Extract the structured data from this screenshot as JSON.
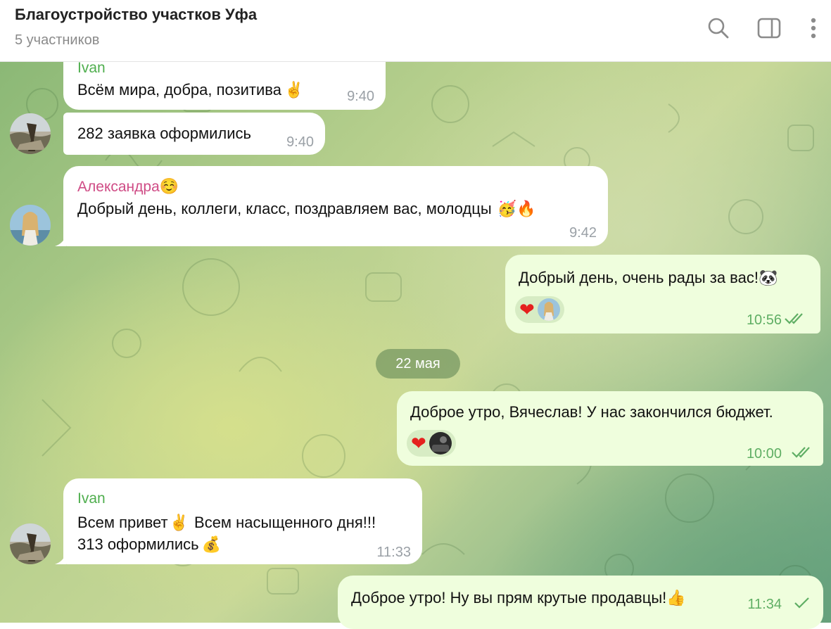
{
  "header": {
    "title": "Благоустройство участков Уфа",
    "subtitle": "5 участников",
    "icons": [
      "search-icon",
      "sidebar-toggle-icon",
      "more-vertical-icon"
    ]
  },
  "messages": [
    {
      "sender": "Ivan",
      "text": "Всём мира, добра, позитива",
      "emoji": "✌️",
      "time": "9:40"
    },
    {
      "text": "282 заявка оформились",
      "time": "9:40"
    },
    {
      "sender": "Александра",
      "sender_emoji": "☺️",
      "text": "Добрый день, коллеги, класс, поздравляем вас, молодцы",
      "emoji": "🥳🔥",
      "time": "9:42"
    },
    {
      "text": "Добрый день, очень рады за вас!",
      "emoji": "🐼",
      "reaction": "❤",
      "time": "10:56"
    },
    {
      "date": "22 мая"
    },
    {
      "text": "Доброе утро, Вячеслав! У нас закончился бюджет.",
      "reaction": "❤",
      "time": "10:00"
    },
    {
      "sender": "Ivan",
      "line1": "Всем привет",
      "emoji1": "✌️",
      "line1b": "Всем насыщенного дня!!!",
      "line2": "313 оформились",
      "emoji2": "💰",
      "time": "11:33"
    },
    {
      "text": "Доброе утро! Ну вы прям крутые продавцы!",
      "emoji": "👍",
      "time": "11:34"
    }
  ],
  "colors": {
    "accent_green": "#4fae4e",
    "sender_pink": "#cf4b85",
    "outgoing_bubble": "#effedd",
    "read_ticks": "#5fae64"
  }
}
